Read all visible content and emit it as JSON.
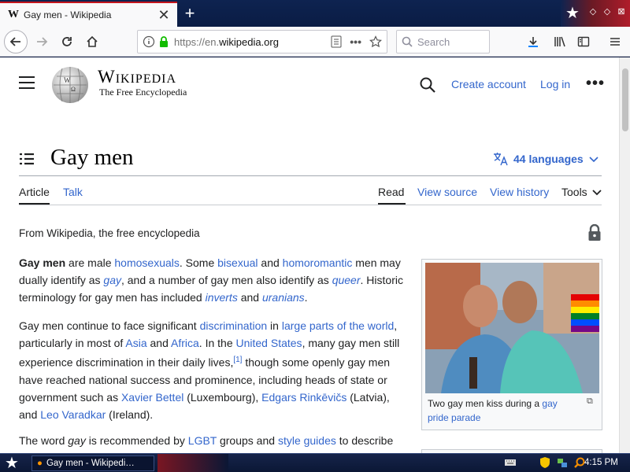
{
  "browser": {
    "tab": {
      "favicon": "W",
      "title": "Gay men - Wikipedia"
    },
    "new_tab_label": "+",
    "url": {
      "prefix": "https://en.",
      "domain": "wikipedia.org"
    },
    "search_placeholder": "Search"
  },
  "wiki": {
    "wordmark": "Wikipedia",
    "tagline": "The Free Encyclopedia",
    "create_account": "Create account",
    "log_in": "Log in",
    "more": "•••",
    "title": "Gay men",
    "languages": "44 languages",
    "tabs": {
      "article": "Article",
      "talk": "Talk",
      "read": "Read",
      "view_source": "View source",
      "view_history": "View history",
      "tools": "Tools"
    },
    "from_wikipedia": "From Wikipedia, the free encyclopedia",
    "para1": [
      "Gay men",
      " are male ",
      "homosexuals",
      ". Some ",
      "bisexual",
      " and ",
      "homoromantic",
      " men may dually identify as ",
      "gay",
      ", and a number of gay men also identify as ",
      "queer",
      ". Historic terminology for gay men has included ",
      "inverts",
      " and ",
      "uranians",
      "."
    ],
    "para2": [
      "Gay men continue to face significant ",
      "discrimination",
      " in ",
      "large parts of the world",
      ", particularly in most of ",
      "Asia",
      " and ",
      "Africa",
      ". In the ",
      "United States",
      ", many gay men still experience discrimination in their daily lives,",
      "[1]",
      " though some openly gay men have reached national success and prominence, including heads of state or government such as ",
      "Xavier Bettel",
      " (Luxembourg), ",
      "Edgars Rinkēvičs",
      " (Latvia), and ",
      "Leo Varadkar",
      " (Ireland)."
    ],
    "para3": [
      "The word ",
      "gay",
      " is recommended by ",
      "LGBT",
      " groups and ",
      "style guides",
      " to describe"
    ],
    "caption": {
      "text": "Two gay men kiss during a ",
      "link": "gay pride parade"
    }
  },
  "taskbar": {
    "task_title": "Gay men - Wikipedi…",
    "clock": "4:15 PM"
  },
  "colors": {
    "link": "#3366cc",
    "text": "#202122",
    "tab_accent": "#c4151c"
  }
}
